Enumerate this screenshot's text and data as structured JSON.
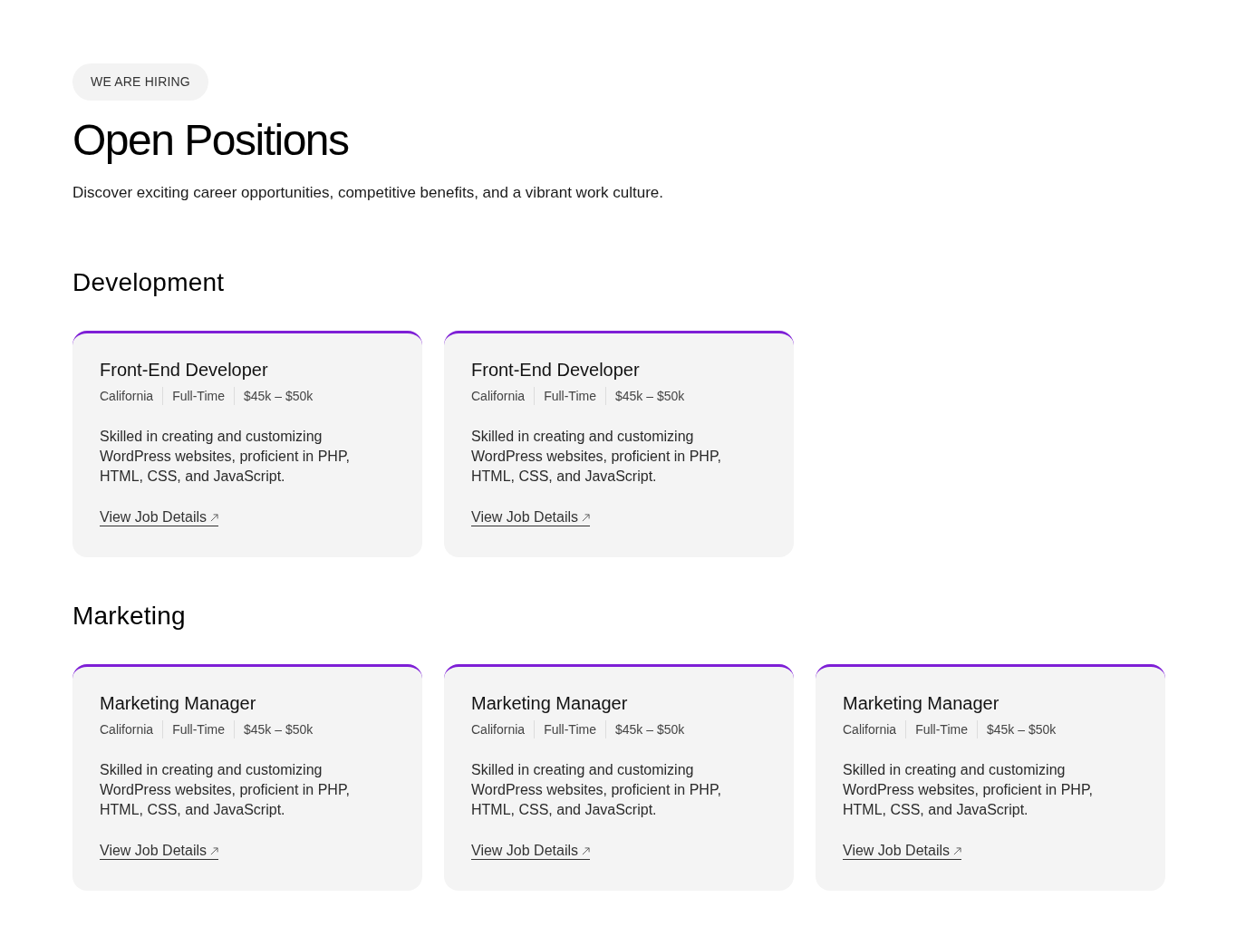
{
  "badge": "WE ARE HIRING",
  "title": "Open Positions",
  "subtitle": "Discover exciting career opportunities, competitive benefits, and a vibrant work culture.",
  "departments": [
    {
      "name": "Development",
      "jobs": [
        {
          "title": "Front-End Developer",
          "location": "California",
          "type": "Full-Time",
          "salary": "$45k – $50k",
          "description": "Skilled in creating and customizing WordPress websites, proficient in PHP, HTML, CSS, and JavaScript.",
          "link": "View Job Details"
        },
        {
          "title": "Front-End Developer",
          "location": "California",
          "type": "Full-Time",
          "salary": "$45k – $50k",
          "description": "Skilled in creating and customizing WordPress websites, proficient in PHP, HTML, CSS, and JavaScript.",
          "link": "View Job Details"
        }
      ]
    },
    {
      "name": "Marketing",
      "jobs": [
        {
          "title": "Marketing Manager",
          "location": "California",
          "type": "Full-Time",
          "salary": "$45k – $50k",
          "description": "Skilled in creating and customizing WordPress websites, proficient in PHP, HTML, CSS, and JavaScript.",
          "link": "View Job Details"
        },
        {
          "title": "Marketing Manager",
          "location": "California",
          "type": "Full-Time",
          "salary": "$45k – $50k",
          "description": "Skilled in creating and customizing WordPress websites, proficient in PHP, HTML, CSS, and JavaScript.",
          "link": "View Job Details"
        },
        {
          "title": "Marketing Manager",
          "location": "California",
          "type": "Full-Time",
          "salary": "$45k – $50k",
          "description": "Skilled in creating and customizing WordPress websites, proficient in PHP, HTML, CSS, and JavaScript.",
          "link": "View Job Details"
        }
      ]
    }
  ]
}
